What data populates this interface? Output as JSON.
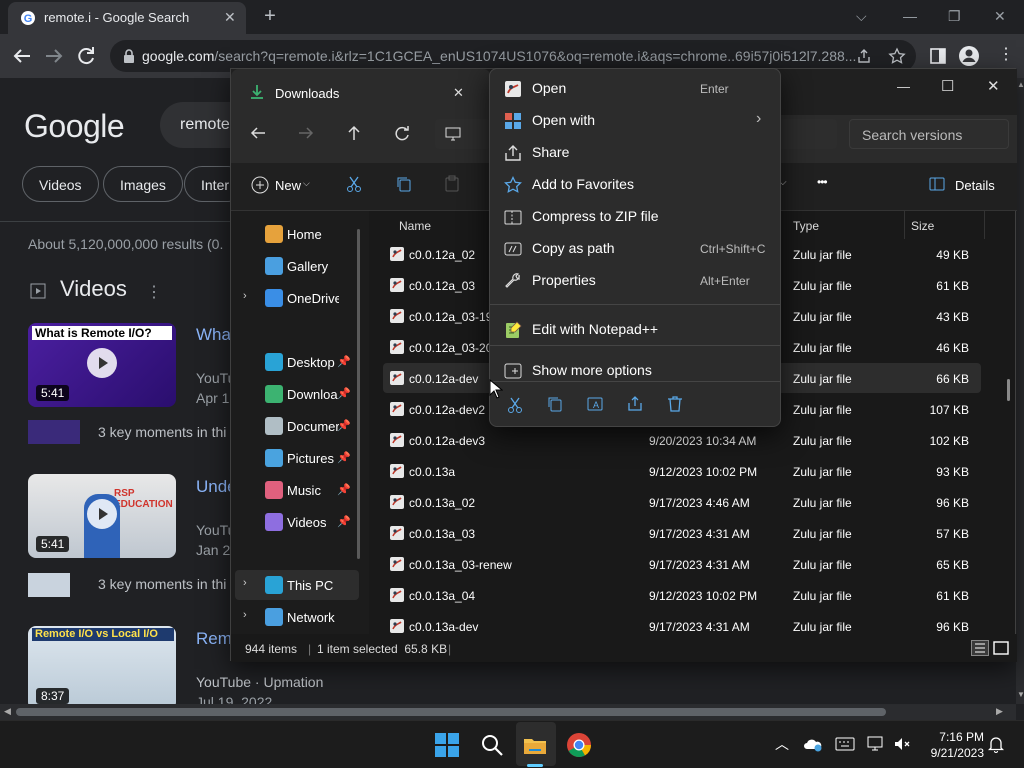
{
  "browser": {
    "tab_title": "remote.i - Google Search",
    "tab_close": "✕",
    "new_tab": "+",
    "url_host": "google.com",
    "url_path": "/search?q=remote.i&rlz=1C1GCEA_enUS1074US1076&oq=remote.i&aqs=chrome..69i57j0i512l7.288...",
    "window_controls": {
      "minimize": "—",
      "restore": "❐",
      "close": "✕"
    }
  },
  "google": {
    "logo": "Google",
    "query": "remote",
    "chips": [
      "Videos",
      "Images",
      "Inter"
    ],
    "stats": "About 5,120,000,000 results (0.",
    "videos_header": "Videos",
    "videos": [
      {
        "thumb_text": "What is Remote I/O?",
        "duration": "5:41",
        "title": "What",
        "source": "YouTu",
        "date": "Apr 1",
        "key_moments": "3 key moments in thi"
      },
      {
        "thumb_text": "RSP EDUCATION",
        "duration": "5:41",
        "title": "Unde",
        "source": "YouTu",
        "date": "Jan 2",
        "key_moments": "3 key moments in thi"
      },
      {
        "thumb_text": "Remote I/O vs Local I/O",
        "duration": "8:37",
        "title": "Rem",
        "source": "YouTube · Upmation",
        "date": "Jul 19, 2022"
      }
    ]
  },
  "explorer": {
    "tab_title": "Downloads",
    "tab_close": "✕",
    "window_controls": {
      "minimize": "—",
      "maximize": "☐",
      "close": "✕"
    },
    "search_placeholder": "Search versions",
    "new_label": "New",
    "details_label": "Details",
    "more_label": "•••",
    "nav_items": [
      {
        "label": "Home",
        "icon": "home-icon",
        "color": "#e6a23c"
      },
      {
        "label": "Gallery",
        "icon": "gallery-icon",
        "color": "#4a9fe0"
      },
      {
        "label": "OneDrive",
        "icon": "onedrive-icon",
        "color": "#3a8ee6",
        "expand": "›"
      },
      {
        "label": "Desktop",
        "icon": "desktop-icon",
        "color": "#29a3d6",
        "pin": "📌"
      },
      {
        "label": "Downloa",
        "icon": "downloads-icon",
        "color": "#3cb371",
        "pin": "📌"
      },
      {
        "label": "Documer",
        "icon": "documents-icon",
        "color": "#b0bec5",
        "pin": "📌"
      },
      {
        "label": "Pictures",
        "icon": "pictures-icon",
        "color": "#4aa3df",
        "pin": "📌"
      },
      {
        "label": "Music",
        "icon": "music-icon",
        "color": "#e0607e",
        "pin": "📌"
      },
      {
        "label": "Videos",
        "icon": "videos-icon",
        "color": "#8e6ee0",
        "pin": "📌"
      },
      {
        "label": "This PC",
        "icon": "this-pc-icon",
        "color": "#29a3d6",
        "expand": "›"
      },
      {
        "label": "Network",
        "icon": "network-icon",
        "color": "#4a9fe0",
        "expand": "›"
      }
    ],
    "columns": {
      "name": "Name",
      "type": "Type",
      "size": "Size"
    },
    "files": [
      {
        "name": "c0.0.12a_02",
        "date": "",
        "type": "Zulu jar file",
        "size": "49 KB"
      },
      {
        "name": "c0.0.12a_03",
        "date": "",
        "type": "Zulu jar file",
        "size": "61 KB"
      },
      {
        "name": "c0.0.12a_03-192",
        "date": "",
        "type": "Zulu jar file",
        "size": "43 KB"
      },
      {
        "name": "c0.0.12a_03-200",
        "date": "",
        "type": "Zulu jar file",
        "size": "46 KB"
      },
      {
        "name": "c0.0.12a-dev",
        "date": "",
        "type": "Zulu jar file",
        "size": "66 KB",
        "selected": true
      },
      {
        "name": "c0.0.12a-dev2",
        "date": "",
        "type": "Zulu jar file",
        "size": "107 KB"
      },
      {
        "name": "c0.0.12a-dev3",
        "date": "9/20/2023 10:34 AM",
        "type": "Zulu jar file",
        "size": "102 KB"
      },
      {
        "name": "c0.0.13a",
        "date": "9/12/2023 10:02 PM",
        "type": "Zulu jar file",
        "size": "93 KB"
      },
      {
        "name": "c0.0.13a_02",
        "date": "9/17/2023 4:46 AM",
        "type": "Zulu jar file",
        "size": "96 KB"
      },
      {
        "name": "c0.0.13a_03",
        "date": "9/17/2023 4:31 AM",
        "type": "Zulu jar file",
        "size": "57 KB"
      },
      {
        "name": "c0.0.13a_03-renew",
        "date": "9/17/2023 4:31 AM",
        "type": "Zulu jar file",
        "size": "65 KB"
      },
      {
        "name": "c0.0.13a_04",
        "date": "9/12/2023 10:02 PM",
        "type": "Zulu jar file",
        "size": "61 KB"
      },
      {
        "name": "c0.0.13a-dev",
        "date": "9/17/2023 4:31 AM",
        "type": "Zulu jar file",
        "size": "96 KB"
      }
    ],
    "status": {
      "count": "944 items",
      "selection": "1 item selected  65.8 KB",
      "sep": "|"
    }
  },
  "context_menu": {
    "items": [
      {
        "label": "Open",
        "shortcut": "Enter",
        "icon": "jar-file-icon"
      },
      {
        "label": "Open with",
        "shortcut": "",
        "icon": "open-with-icon",
        "submenu": "›"
      },
      {
        "label": "Share",
        "shortcut": "",
        "icon": "share-icon"
      },
      {
        "label": "Add to Favorites",
        "shortcut": "",
        "icon": "star-icon"
      },
      {
        "label": "Compress to ZIP file",
        "shortcut": "",
        "icon": "zip-icon"
      },
      {
        "label": "Copy as path",
        "shortcut": "Ctrl+Shift+C",
        "icon": "copy-path-icon"
      },
      {
        "label": "Properties",
        "shortcut": "Alt+Enter",
        "icon": "wrench-icon"
      },
      {
        "label": "Edit with Notepad++",
        "shortcut": "",
        "icon": "notepad-plus-plus-icon"
      },
      {
        "label": "Show more options",
        "shortcut": "",
        "icon": "more-options-icon"
      }
    ],
    "quick_actions": [
      "cut-icon",
      "copy-icon",
      "rename-icon",
      "share-icon",
      "delete-icon"
    ]
  },
  "taskbar": {
    "time": "7:16 PM",
    "date": "9/21/2023"
  },
  "colors": {
    "accent": "#60cdff",
    "link": "#8ab4f8"
  }
}
